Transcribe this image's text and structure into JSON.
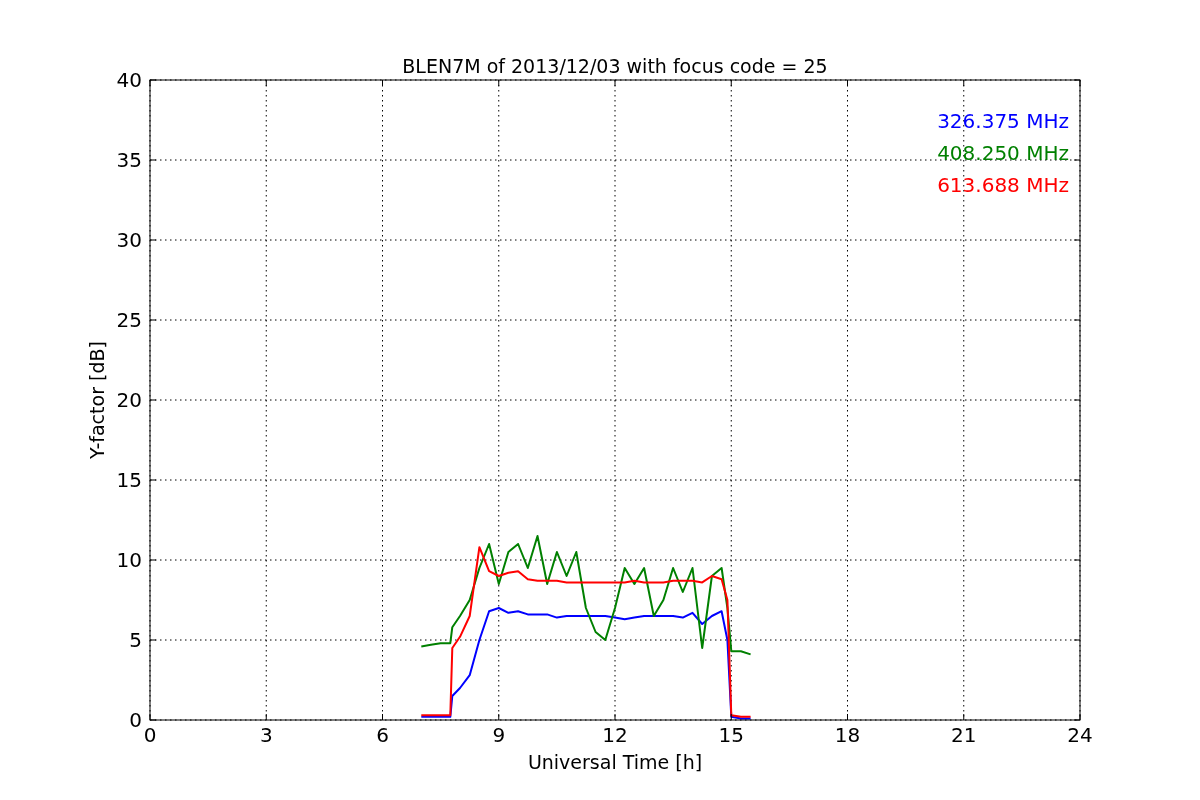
{
  "figure": {
    "chart_data": {
      "type": "line",
      "title": "BLEN7M of 2013/12/03 with focus code = 25",
      "xlabel": "Universal Time [h]",
      "ylabel": "Y-factor [dB]",
      "grid": true,
      "xlim": [
        0,
        24
      ],
      "ylim": [
        0,
        40
      ],
      "xticks": [
        0,
        3,
        6,
        9,
        12,
        15,
        18,
        21,
        24
      ],
      "yticks": [
        0,
        5,
        10,
        15,
        20,
        25,
        30,
        35,
        40
      ],
      "x": [
        7,
        7.25,
        7.5,
        7.75,
        7.8,
        8,
        8.25,
        8.5,
        8.75,
        9,
        9.25,
        9.5,
        9.75,
        10,
        10.25,
        10.5,
        10.75,
        11,
        11.25,
        11.5,
        11.75,
        12,
        12.25,
        12.5,
        12.75,
        13,
        13.25,
        13.5,
        13.75,
        14,
        14.25,
        14.5,
        14.75,
        14.9,
        15,
        15.25,
        15.5
      ],
      "series": [
        {
          "name": "326.375 MHz",
          "color": "#0000ff",
          "values": [
            0.2,
            0.2,
            0.2,
            0.2,
            1.5,
            2,
            2.8,
            5,
            6.8,
            7,
            6.7,
            6.8,
            6.6,
            6.6,
            6.6,
            6.4,
            6.5,
            6.5,
            6.5,
            6.5,
            6.5,
            6.4,
            6.3,
            6.4,
            6.5,
            6.5,
            6.5,
            6.5,
            6.4,
            6.7,
            6,
            6.5,
            6.8,
            5,
            0.2,
            0.1,
            0.1
          ]
        },
        {
          "name": "408.250 MHz",
          "color": "#008000",
          "values": [
            4.6,
            4.7,
            4.8,
            4.8,
            5.8,
            6.5,
            7.5,
            9.5,
            11,
            8.5,
            10.5,
            11,
            9.5,
            11.5,
            8.5,
            10.5,
            9,
            10.5,
            7,
            5.5,
            5,
            7,
            9.5,
            8.5,
            9.5,
            6.5,
            7.5,
            9.5,
            8,
            9.5,
            4.5,
            9,
            9.5,
            7,
            4.3,
            4.3,
            4.1
          ]
        },
        {
          "name": "613.688 MHz",
          "color": "#ff0000",
          "values": [
            0.3,
            0.3,
            0.3,
            0.3,
            4.5,
            5.2,
            6.5,
            10.8,
            9.3,
            9,
            9.2,
            9.3,
            8.8,
            8.7,
            8.7,
            8.7,
            8.6,
            8.6,
            8.6,
            8.6,
            8.6,
            8.6,
            8.6,
            8.7,
            8.6,
            8.6,
            8.6,
            8.7,
            8.7,
            8.7,
            8.6,
            9,
            8.8,
            7.5,
            0.3,
            0.2,
            0.2
          ]
        }
      ]
    }
  }
}
